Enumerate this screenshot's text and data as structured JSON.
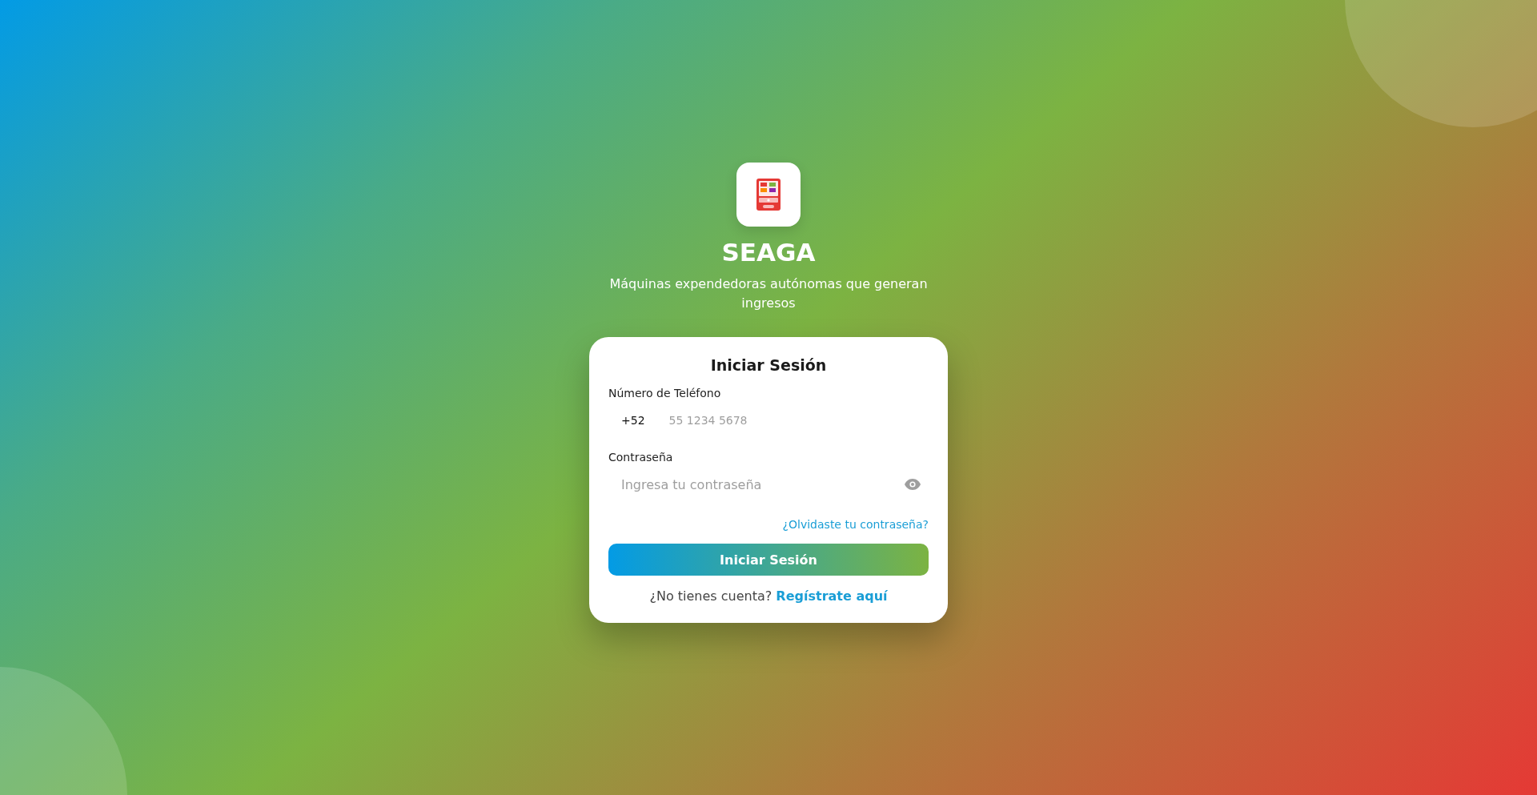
{
  "brand": {
    "name": "SEAGA",
    "tagline": "Máquinas expendedoras autónomas que generan ingresos"
  },
  "login_card": {
    "title": "Iniciar Sesión",
    "phone": {
      "label": "Número de Teléfono",
      "country_code": "+52",
      "placeholder": "55 1234 5678"
    },
    "password": {
      "label": "Contraseña",
      "placeholder": "Ingresa tu contraseña"
    },
    "forgot_link": "¿Olvidaste tu contraseña?",
    "submit_button": "Iniciar Sesión",
    "signup_prompt": "¿No tienes cuenta?",
    "signup_link": "Regístrate aquí"
  }
}
